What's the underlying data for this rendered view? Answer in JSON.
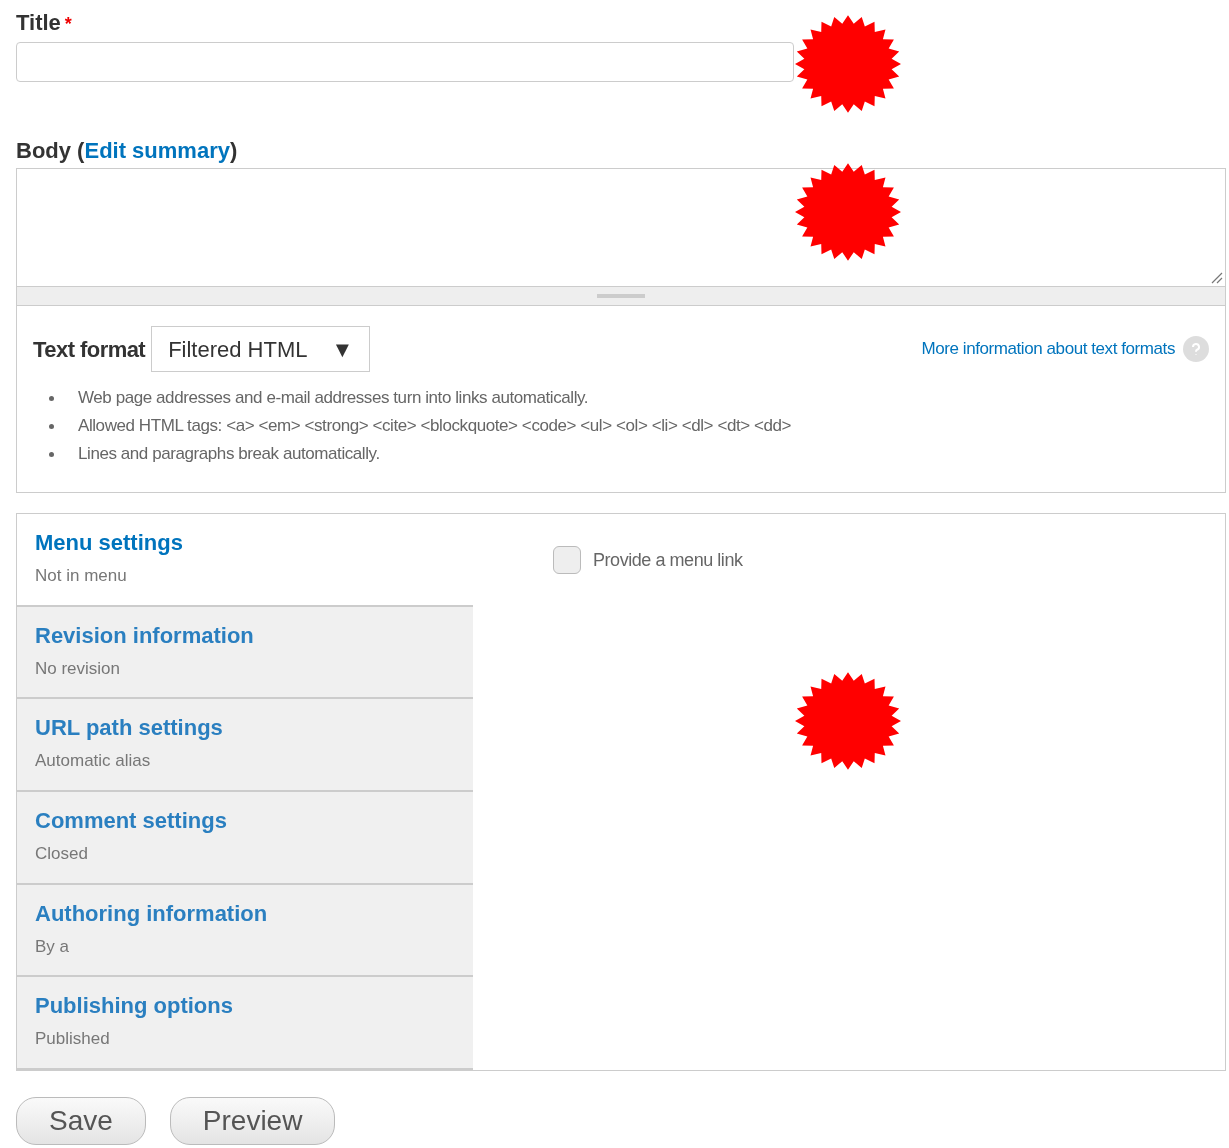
{
  "title_field": {
    "label": "Title",
    "required_mark": "*"
  },
  "body_field": {
    "label": "Body (",
    "link": "Edit summary",
    "label_end": ")"
  },
  "text_format": {
    "label": "Text format",
    "select_value": "Filtered HTML",
    "select_arrow": "▼",
    "help_link": "More information about text formats",
    "tips": [
      "Web page addresses and e-mail addresses turn into links automatically.",
      "Allowed HTML tags: <a> <em> <strong> <cite> <blockquote> <code> <ul> <ol> <li> <dl> <dt> <dd>",
      "Lines and paragraphs break automatically."
    ]
  },
  "vertical_tabs": [
    {
      "title": "Menu settings",
      "summary": "Not in menu",
      "selected": true
    },
    {
      "title": "Revision information",
      "summary": "No revision",
      "selected": false
    },
    {
      "title": "URL path settings",
      "summary": "Automatic alias",
      "selected": false
    },
    {
      "title": "Comment settings",
      "summary": "Closed",
      "selected": false
    },
    {
      "title": "Authoring information",
      "summary": "By a",
      "selected": false
    },
    {
      "title": "Publishing options",
      "summary": "Published",
      "selected": false
    }
  ],
  "menu_pane": {
    "checkbox_label": "Provide a menu link",
    "checked": false
  },
  "buttons": [
    "Save",
    "Preview"
  ]
}
